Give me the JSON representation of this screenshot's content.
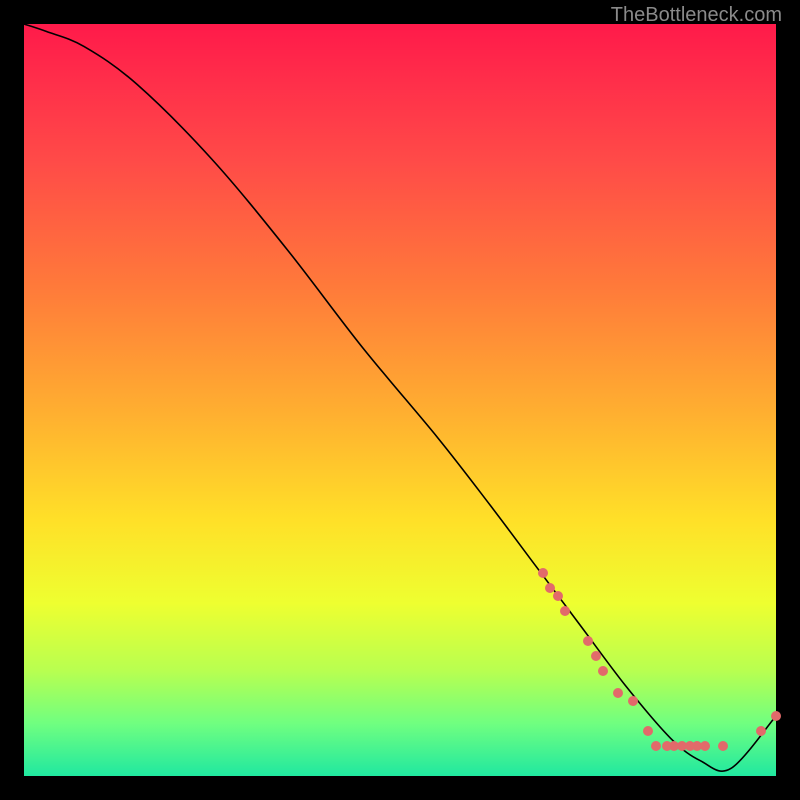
{
  "attribution": "TheBottleneck.com",
  "chart_data": {
    "type": "line",
    "title": "",
    "xlabel": "",
    "ylabel": "",
    "xlim": [
      0,
      100
    ],
    "ylim": [
      0,
      100
    ],
    "series": [
      {
        "name": "curve",
        "x": [
          0,
          3,
          8,
          15,
          25,
          35,
          45,
          55,
          62,
          68,
          74,
          80,
          86,
          90,
          94,
          100
        ],
        "values": [
          100,
          99,
          97,
          92,
          82,
          70,
          57,
          45,
          36,
          28,
          20,
          12,
          5,
          2,
          1,
          8
        ]
      }
    ],
    "scatter_points": [
      {
        "x": 69,
        "y": 27
      },
      {
        "x": 70,
        "y": 25
      },
      {
        "x": 71,
        "y": 24
      },
      {
        "x": 72,
        "y": 22
      },
      {
        "x": 75,
        "y": 18
      },
      {
        "x": 76,
        "y": 16
      },
      {
        "x": 77,
        "y": 14
      },
      {
        "x": 79,
        "y": 11
      },
      {
        "x": 81,
        "y": 10
      },
      {
        "x": 83,
        "y": 6
      },
      {
        "x": 84,
        "y": 4
      },
      {
        "x": 85.5,
        "y": 4
      },
      {
        "x": 86.5,
        "y": 4
      },
      {
        "x": 87.5,
        "y": 4
      },
      {
        "x": 88.5,
        "y": 4
      },
      {
        "x": 89.5,
        "y": 4
      },
      {
        "x": 90.5,
        "y": 4
      },
      {
        "x": 93,
        "y": 4
      },
      {
        "x": 98,
        "y": 6
      },
      {
        "x": 100,
        "y": 8
      }
    ]
  }
}
